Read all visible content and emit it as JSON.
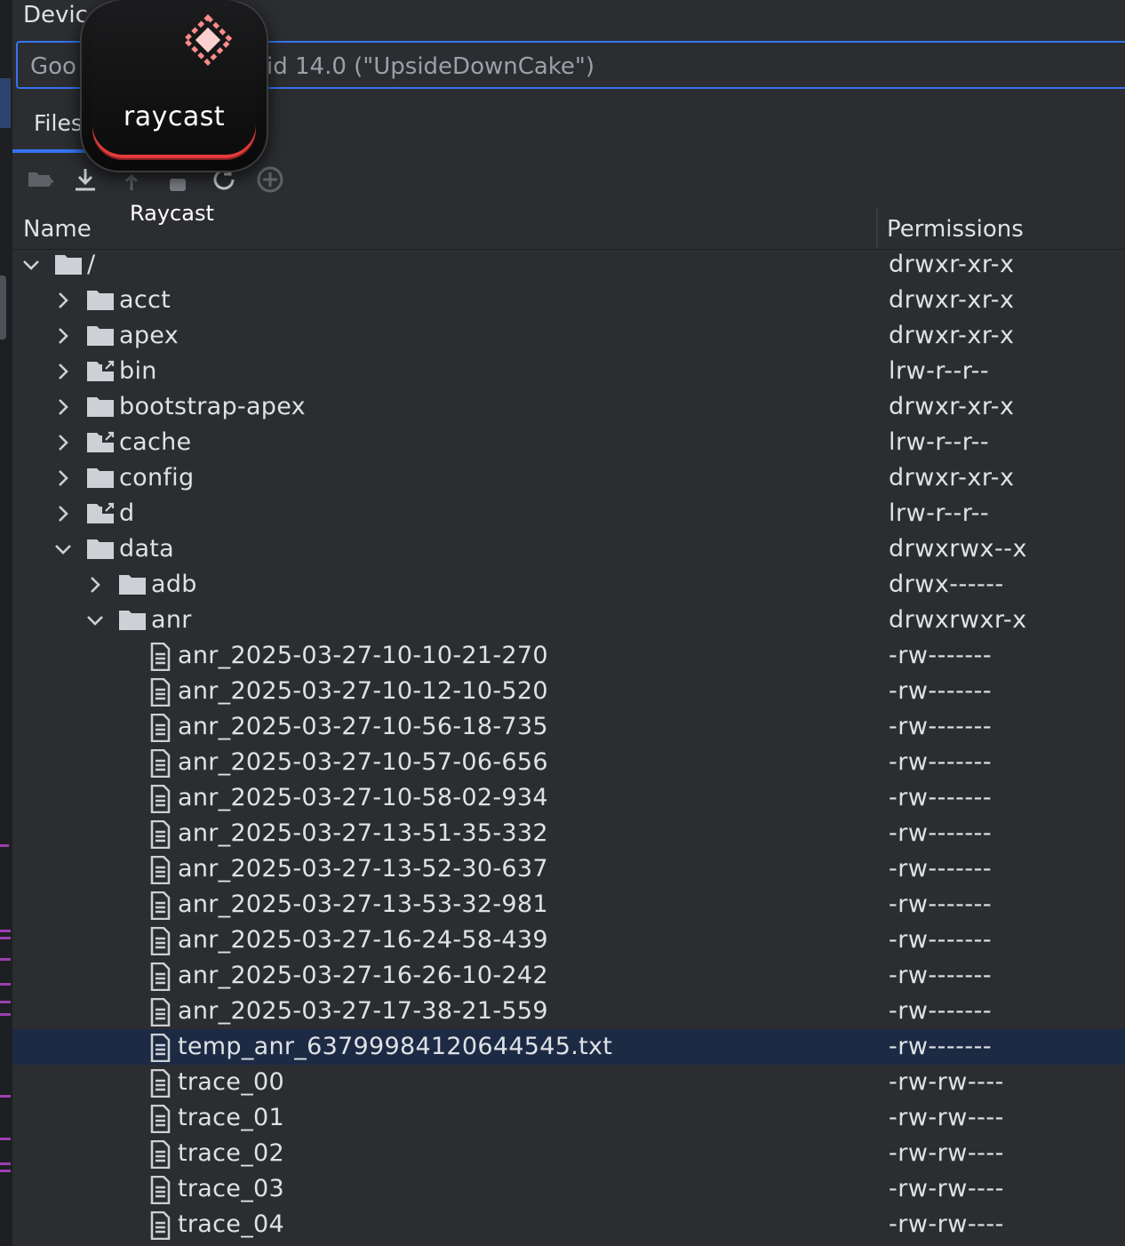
{
  "window": {
    "title": "Devic"
  },
  "device_selector": {
    "value": "Goo",
    "value_tail": "roid 14.0 (\"UpsideDownCake\")"
  },
  "tabs": [
    {
      "label": "Files",
      "selected": true
    }
  ],
  "toolbar": {
    "buttons": [
      {
        "name": "new-folder-icon",
        "enabled": false
      },
      {
        "name": "download-icon",
        "enabled": true
      },
      {
        "name": "upload-icon",
        "enabled": false
      },
      {
        "name": "delete-icon",
        "enabled": false
      },
      {
        "name": "refresh-icon",
        "enabled": true
      },
      {
        "name": "add-device-icon",
        "enabled": false
      }
    ]
  },
  "overlay": {
    "app_label": "raycast",
    "caption": "Raycast"
  },
  "columns": {
    "name": "Name",
    "permissions": "Permissions"
  },
  "tree": [
    {
      "depth": 0,
      "expand": "open",
      "type": "folder",
      "label": "/",
      "perms": "drwxr-xr-x"
    },
    {
      "depth": 1,
      "expand": "closed",
      "type": "folder",
      "label": "acct",
      "perms": "drwxr-xr-x"
    },
    {
      "depth": 1,
      "expand": "closed",
      "type": "folder",
      "label": "apex",
      "perms": "drwxr-xr-x"
    },
    {
      "depth": 1,
      "expand": "closed",
      "type": "folder-link",
      "label": "bin",
      "perms": "lrw-r--r--"
    },
    {
      "depth": 1,
      "expand": "closed",
      "type": "folder",
      "label": "bootstrap-apex",
      "perms": "drwxr-xr-x"
    },
    {
      "depth": 1,
      "expand": "closed",
      "type": "folder-link",
      "label": "cache",
      "perms": "lrw-r--r--"
    },
    {
      "depth": 1,
      "expand": "closed",
      "type": "folder",
      "label": "config",
      "perms": "drwxr-xr-x"
    },
    {
      "depth": 1,
      "expand": "closed",
      "type": "folder-link",
      "label": "d",
      "perms": "lrw-r--r--"
    },
    {
      "depth": 1,
      "expand": "open",
      "type": "folder",
      "label": "data",
      "perms": "drwxrwx--x"
    },
    {
      "depth": 2,
      "expand": "closed",
      "type": "folder",
      "label": "adb",
      "perms": "drwx------"
    },
    {
      "depth": 2,
      "expand": "open",
      "type": "folder",
      "label": "anr",
      "perms": "drwxrwxr-x"
    },
    {
      "depth": 3,
      "expand": "none",
      "type": "file",
      "label": "anr_2025-03-27-10-10-21-270",
      "perms": "-rw-------"
    },
    {
      "depth": 3,
      "expand": "none",
      "type": "file",
      "label": "anr_2025-03-27-10-12-10-520",
      "perms": "-rw-------"
    },
    {
      "depth": 3,
      "expand": "none",
      "type": "file",
      "label": "anr_2025-03-27-10-56-18-735",
      "perms": "-rw-------"
    },
    {
      "depth": 3,
      "expand": "none",
      "type": "file",
      "label": "anr_2025-03-27-10-57-06-656",
      "perms": "-rw-------"
    },
    {
      "depth": 3,
      "expand": "none",
      "type": "file",
      "label": "anr_2025-03-27-10-58-02-934",
      "perms": "-rw-------"
    },
    {
      "depth": 3,
      "expand": "none",
      "type": "file",
      "label": "anr_2025-03-27-13-51-35-332",
      "perms": "-rw-------"
    },
    {
      "depth": 3,
      "expand": "none",
      "type": "file",
      "label": "anr_2025-03-27-13-52-30-637",
      "perms": "-rw-------"
    },
    {
      "depth": 3,
      "expand": "none",
      "type": "file",
      "label": "anr_2025-03-27-13-53-32-981",
      "perms": "-rw-------"
    },
    {
      "depth": 3,
      "expand": "none",
      "type": "file",
      "label": "anr_2025-03-27-16-24-58-439",
      "perms": "-rw-------"
    },
    {
      "depth": 3,
      "expand": "none",
      "type": "file",
      "label": "anr_2025-03-27-16-26-10-242",
      "perms": "-rw-------"
    },
    {
      "depth": 3,
      "expand": "none",
      "type": "file",
      "label": "anr_2025-03-27-17-38-21-559",
      "perms": "-rw-------"
    },
    {
      "depth": 3,
      "expand": "none",
      "type": "file",
      "label": "temp_anr_637999841206445​45.txt",
      "perms": "-rw-------",
      "selected": true
    },
    {
      "depth": 3,
      "expand": "none",
      "type": "file",
      "label": "trace_00",
      "perms": "-rw-rw----"
    },
    {
      "depth": 3,
      "expand": "none",
      "type": "file",
      "label": "trace_01",
      "perms": "-rw-rw----"
    },
    {
      "depth": 3,
      "expand": "none",
      "type": "file",
      "label": "trace_02",
      "perms": "-rw-rw----"
    },
    {
      "depth": 3,
      "expand": "none",
      "type": "file",
      "label": "trace_03",
      "perms": "-rw-rw----"
    },
    {
      "depth": 3,
      "expand": "none",
      "type": "file",
      "label": "trace_04",
      "perms": "-rw-rw----"
    }
  ],
  "colors": {
    "background": "#2b2d30",
    "accent": "#3574f0",
    "selection": "#1d2a44",
    "raycast_red": "#e23b3b"
  }
}
